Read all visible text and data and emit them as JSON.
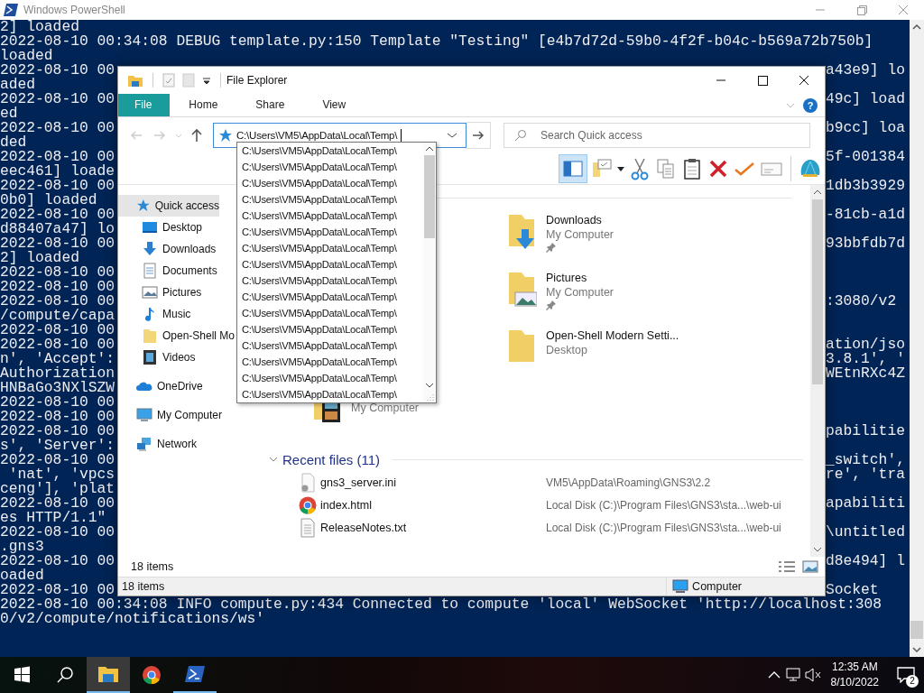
{
  "powershell": {
    "title": "Windows PowerShell",
    "lines": [
      {
        "left": "2] loaded"
      },
      {
        "left": "2022-08-10 00:34:08 DEBUG template.py:150 Template \"Testing\" [e4b7d72d-59b0-4f2f-b04c-b569a72b750b]"
      },
      {
        "left": "loaded"
      },
      {
        "left": "2022-08-10 00",
        "right": "a43e9] lo"
      },
      {
        "left": "aded"
      },
      {
        "left": "2022-08-10 00",
        "right": "49c] load"
      },
      {
        "left": "ed"
      },
      {
        "left": "2022-08-10 00",
        "right": "b9cc] loa"
      },
      {
        "left": "ded"
      },
      {
        "left": "2022-08-10 00",
        "right": "5f-001384"
      },
      {
        "left": "eec461] loade"
      },
      {
        "left": "2022-08-10 00",
        "right": "1db3b3929"
      },
      {
        "left": "0b0] loaded"
      },
      {
        "left": "2022-08-10 00",
        "right": "-81cb-a1d"
      },
      {
        "left": "d88407a47] lo"
      },
      {
        "left": "2022-08-10 00",
        "right": "93bbfdb7d"
      },
      {
        "left": "2] loaded"
      },
      {
        "left": "2022-08-10 00"
      },
      {
        "left": "2022-08-10 00"
      },
      {
        "left": "2022-08-10 00",
        "right": ":3080/v2"
      },
      {
        "left": "/compute/capa"
      },
      {
        "left": "2022-08-10 00"
      },
      {
        "left": "2022-08-10 00",
        "right": "ation/jso"
      },
      {
        "left": "n', 'Accept':",
        "right": "3.8.1', '"
      },
      {
        "left": "Authorization",
        "right": "WEtnRXc4Z"
      },
      {
        "left": "HNBaGo3NXlSZW"
      },
      {
        "left": "2022-08-10 00"
      },
      {
        "left": "2022-08-10 00"
      },
      {
        "left": "2022-08-10 00",
        "right": "pabilitie"
      },
      {
        "left": "s', 'Server':"
      },
      {
        "left": "2022-08-10 00",
        "right": "_switch',"
      },
      {
        "left": " 'nat', 'vpcs",
        "right": "re', 'tra"
      },
      {
        "left": "ceng'], 'plat"
      },
      {
        "left": "2022-08-10 00",
        "right": "apabiliti"
      },
      {
        "left": "es HTTP/1.1\""
      },
      {
        "left": "2022-08-10 00",
        "right": "\\untitled"
      },
      {
        "left": ".gns3"
      },
      {
        "left": "2022-08-10 00",
        "right": "d8e494] l"
      },
      {
        "left": "oaded"
      },
      {
        "left": "2022-08-10 00",
        "right": "Socket"
      },
      {
        "left": "2022-08-10 00:34:08 INFO compute.py:434 Connected to compute 'local' WebSocket 'http://localhost:308"
      },
      {
        "left": "0/v2/compute/notifications/ws'"
      }
    ]
  },
  "explorer": {
    "title": "File Explorer",
    "ribbon_tabs": [
      {
        "label": "File",
        "selected": true
      },
      {
        "label": "Home",
        "selected": false
      },
      {
        "label": "Share",
        "selected": false
      },
      {
        "label": "View",
        "selected": false
      }
    ],
    "help": "?",
    "address": {
      "value": "C:\\Users\\VM5\\AppData\\Local\\Temp\\"
    },
    "search": {
      "placeholder": "Search Quick access"
    },
    "preview_pane": {
      "on": true
    },
    "autocomplete": [
      "C:\\Users\\VM5\\AppData\\Local\\Temp\\",
      "C:\\Users\\VM5\\AppData\\Local\\Temp\\",
      "C:\\Users\\VM5\\AppData\\Local\\Temp\\",
      "C:\\Users\\VM5\\AppData\\Local\\Temp\\",
      "C:\\Users\\VM5\\AppData\\Local\\Temp\\",
      "C:\\Users\\VM5\\AppData\\Local\\Temp\\",
      "C:\\Users\\VM5\\AppData\\Local\\Temp\\",
      "C:\\Users\\VM5\\AppData\\Local\\Temp\\",
      "C:\\Users\\VM5\\AppData\\Local\\Temp\\",
      "C:\\Users\\VM5\\AppData\\Local\\Temp\\",
      "C:\\Users\\VM5\\AppData\\Local\\Temp\\",
      "C:\\Users\\VM5\\AppData\\Local\\Temp\\",
      "C:\\Users\\VM5\\AppData\\Local\\Temp\\",
      "C:\\Users\\VM5\\AppData\\Local\\Temp\\",
      "C:\\Users\\VM5\\AppData\\Local\\Temp\\",
      "C:\\Users\\VM5\\AppData\\Local\\Temp\\"
    ],
    "sidebar": [
      {
        "label": "Quick access",
        "kind": "star",
        "selected": true,
        "children": [
          {
            "label": "Desktop",
            "kind": "desktop",
            "selected": false
          },
          {
            "label": "Downloads",
            "kind": "downloads",
            "selected": false
          },
          {
            "label": "Documents",
            "kind": "documents",
            "selected": false
          },
          {
            "label": "Pictures",
            "kind": "pictures",
            "selected": false
          },
          {
            "label": "Music",
            "kind": "music",
            "selected": false
          },
          {
            "label": "Open-Shell Mo",
            "kind": "folder",
            "selected": false
          },
          {
            "label": "Videos",
            "kind": "videos",
            "selected": false
          }
        ]
      },
      {
        "label": "OneDrive",
        "kind": "cloud",
        "selected": false
      },
      {
        "label": "My Computer",
        "kind": "computer",
        "selected": false
      },
      {
        "label": "Network",
        "kind": "network",
        "selected": false
      }
    ],
    "frequent_folders": [
      {
        "name": "Downloads",
        "location": "My Computer",
        "kind": "downloads",
        "pinned": true
      },
      {
        "name": "Pictures",
        "location": "My Computer",
        "kind": "pictures",
        "pinned": true
      },
      {
        "name": "Open-Shell Modern Setti...",
        "location": "Desktop",
        "kind": "folder",
        "pinned": false
      },
      {
        "location": "My Computer",
        "kind": "videos",
        "pinned": false
      }
    ],
    "recent_files": {
      "heading": "Recent files (11)",
      "expanded": true,
      "items": [
        {
          "name": "gns3_server.ini",
          "path": "VM5\\AppData\\Roaming\\GNS3\\2.2",
          "kind": "settings"
        },
        {
          "name": "index.html",
          "path": "Local Disk (C:)\\Program Files\\GNS3\\sta...\\web-ui",
          "kind": "browser"
        },
        {
          "name": "ReleaseNotes.txt",
          "path": "Local Disk (C:)\\Program Files\\GNS3\\sta...\\web-ui",
          "kind": "text"
        }
      ]
    },
    "item_count": "18 items",
    "status_bar": {
      "left": "18 items",
      "right": "Computer"
    }
  },
  "taskbar": {
    "apps": [
      {
        "kind": "explorer",
        "selected": true,
        "running": true
      },
      {
        "kind": "chrome",
        "selected": false,
        "running": false
      },
      {
        "kind": "powershell",
        "selected": false,
        "running": true
      }
    ],
    "time": "12:35 AM",
    "date": "8/10/2022",
    "notifications": "2"
  }
}
